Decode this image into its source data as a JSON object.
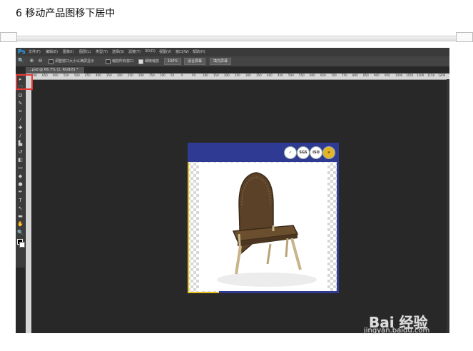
{
  "step": {
    "title": "6 移动产品图移下居中"
  },
  "app": {
    "logo": "Ps",
    "menu": [
      "文件(F)",
      "编辑(E)",
      "图像(I)",
      "图层(L)",
      "类型(Y)",
      "选择(S)",
      "滤镜(T)",
      "3D(D)",
      "视图(V)",
      "窗口(W)",
      "帮助(H)"
    ],
    "options": {
      "check1_label": "调整窗口大小以满屏显示",
      "check2_label": "缩放所有窗口",
      "check3_label": "细微缩放",
      "zoom_btn": "100%",
      "fit_btn": "适合屏幕",
      "fill_btn": "填充屏幕"
    },
    "document_tab": "...psd @ 66.7% (1, RGB/8) *",
    "ruler_ticks": [
      "700",
      "650",
      "600",
      "550",
      "500",
      "450",
      "400",
      "350",
      "300",
      "250",
      "200",
      "150",
      "100",
      "50",
      "0",
      "50",
      "100",
      "150",
      "200",
      "250",
      "300",
      "350",
      "400",
      "450",
      "500",
      "550",
      "600",
      "650",
      "700",
      "750",
      "800",
      "850",
      "900",
      "950",
      "1000",
      "1050",
      "1100",
      "1150",
      "1200",
      "1250"
    ],
    "tools": [
      "move-tool",
      "marquee-tool",
      "lasso-tool",
      "quick-select-tool",
      "crop-tool",
      "eyedropper-tool",
      "healing-tool",
      "brush-tool",
      "clone-stamp-tool",
      "history-brush-tool",
      "eraser-tool",
      "gradient-tool",
      "blur-tool",
      "dodge-tool",
      "pen-tool",
      "type-tool",
      "path-select-tool",
      "shape-tool",
      "hand-tool",
      "zoom-tool"
    ],
    "tool_glyphs": [
      "▸",
      "⬚",
      "ʘ",
      "✎",
      "⌗",
      "⁄",
      "✚",
      "∕",
      "▙",
      "↺",
      "◧",
      "▭",
      "◆",
      "●",
      "✒",
      "T",
      "↖",
      "▬",
      "✋",
      "🔍"
    ]
  },
  "canvas": {
    "badges": [
      "✓",
      "SGS",
      "ISO",
      "★"
    ]
  },
  "watermark": {
    "brand": "Bai 经验",
    "url": "jingyan.baidu.com"
  },
  "colors": {
    "banner": "#2f3b93",
    "highlight": "#e53935",
    "accent": "#e8c11c"
  }
}
